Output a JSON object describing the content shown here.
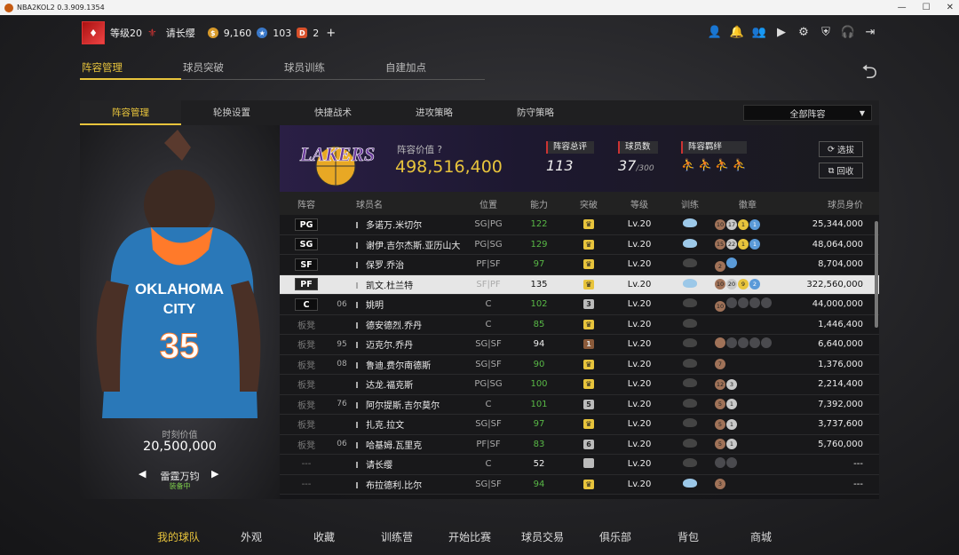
{
  "window": {
    "title": "NBA2KOL2 0.3.909.1354",
    "min": "—",
    "max": "☐",
    "close": "✕"
  },
  "user": {
    "level": "等级20",
    "name": "请长缨",
    "coins": "9,160",
    "tickets": "103",
    "tokens": "2",
    "add": "+"
  },
  "main_tabs": [
    {
      "label": "阵容管理"
    },
    {
      "label": "球员突破"
    },
    {
      "label": "球员训练"
    },
    {
      "label": "自建加点"
    }
  ],
  "sub_tabs": [
    {
      "label": "阵容管理"
    },
    {
      "label": "轮换设置"
    },
    {
      "label": "快捷战术"
    },
    {
      "label": "进攻策略"
    },
    {
      "label": "防守策略"
    }
  ],
  "lineup_select": "全部阵容",
  "player_card": {
    "label": "时刻价值",
    "value": "20,500,000",
    "name": "雷霆万钧",
    "status": "装备中"
  },
  "team": {
    "value_label": "阵容价值",
    "value": "498,516,400",
    "rating_label": "阵容总评",
    "rating": "113",
    "count_label": "球员数",
    "count": "37",
    "count_max": "/300",
    "bond_label": "阵容羁绊",
    "btn_pick": "选拔",
    "btn_recycle": "回收"
  },
  "table": {
    "headers": [
      "阵容",
      "球员名",
      "位置",
      "能力",
      "突破",
      "等级",
      "训练",
      "徽章",
      "球员身价"
    ],
    "rows": [
      {
        "pos": "PG",
        "no": "",
        "name": "多诺万.米切尔",
        "slot": "SG|PG",
        "ovr": "122",
        "br": "♛",
        "lv": "Lv.20",
        "val": "25,344,000"
      },
      {
        "pos": "SG",
        "no": "",
        "name": "谢伊.吉尔杰斯.亚历山大",
        "slot": "PG|SG",
        "ovr": "129",
        "br": "♛",
        "lv": "Lv.20",
        "val": "48,064,000"
      },
      {
        "pos": "SF",
        "no": "",
        "name": "保罗.乔治",
        "slot": "PF|SF",
        "ovr": "97",
        "br": "♛",
        "lv": "Lv.20",
        "val": "8,704,000"
      },
      {
        "pos": "PF",
        "no": "",
        "name": "凯文.杜兰特",
        "slot": "SF|PF",
        "ovr": "135",
        "br": "♛",
        "lv": "Lv.20",
        "val": "322,560,000"
      },
      {
        "pos": "C",
        "no": "06",
        "name": "姚明",
        "slot": "C",
        "ovr": "102",
        "br": "3",
        "lv": "Lv.20",
        "val": "44,000,000"
      },
      {
        "pos": "板凳",
        "no": "",
        "name": "德安德烈.乔丹",
        "slot": "C",
        "ovr": "85",
        "br": "♛",
        "lv": "Lv.20",
        "val": "1,446,400"
      },
      {
        "pos": "板凳",
        "no": "95",
        "name": "迈克尔.乔丹",
        "slot": "SG|SF",
        "ovr": "94",
        "br": "1",
        "lv": "Lv.20",
        "val": "6,640,000"
      },
      {
        "pos": "板凳",
        "no": "08",
        "name": "鲁迪.费尔南德斯",
        "slot": "SG|SF",
        "ovr": "90",
        "br": "♛",
        "lv": "Lv.20",
        "val": "1,376,000"
      },
      {
        "pos": "板凳",
        "no": "",
        "name": "达龙.福克斯",
        "slot": "PG|SG",
        "ovr": "100",
        "br": "♛",
        "lv": "Lv.20",
        "val": "2,214,400"
      },
      {
        "pos": "板凳",
        "no": "76",
        "name": "阿尔提斯.吉尔莫尔",
        "slot": "C",
        "ovr": "101",
        "br": "5",
        "lv": "Lv.20",
        "val": "7,392,000"
      },
      {
        "pos": "板凳",
        "no": "",
        "name": "扎克.拉文",
        "slot": "SG|SF",
        "ovr": "97",
        "br": "♛",
        "lv": "Lv.20",
        "val": "3,737,600"
      },
      {
        "pos": "板凳",
        "no": "06",
        "name": "哈基姆.瓦里克",
        "slot": "PF|SF",
        "ovr": "83",
        "br": "6",
        "lv": "Lv.20",
        "val": "5,760,000"
      },
      {
        "pos": "---",
        "no": "",
        "name": "请长缨",
        "slot": "C",
        "ovr": "52",
        "br": "",
        "lv": "Lv.20",
        "val": "---"
      },
      {
        "pos": "---",
        "no": "",
        "name": "布拉德利.比尔",
        "slot": "SG|SF",
        "ovr": "94",
        "br": "♛",
        "lv": "Lv.20",
        "val": "---"
      }
    ]
  },
  "bottom_nav": [
    {
      "label": "我的球队"
    },
    {
      "label": "外观"
    },
    {
      "label": "收藏"
    },
    {
      "label": "训练营"
    },
    {
      "label": "开始比赛"
    },
    {
      "label": "球员交易"
    },
    {
      "label": "俱乐部"
    },
    {
      "label": "背包"
    },
    {
      "label": "商城"
    }
  ],
  "colors": {
    "accent": "#e8c43c",
    "green": "#58b846"
  }
}
